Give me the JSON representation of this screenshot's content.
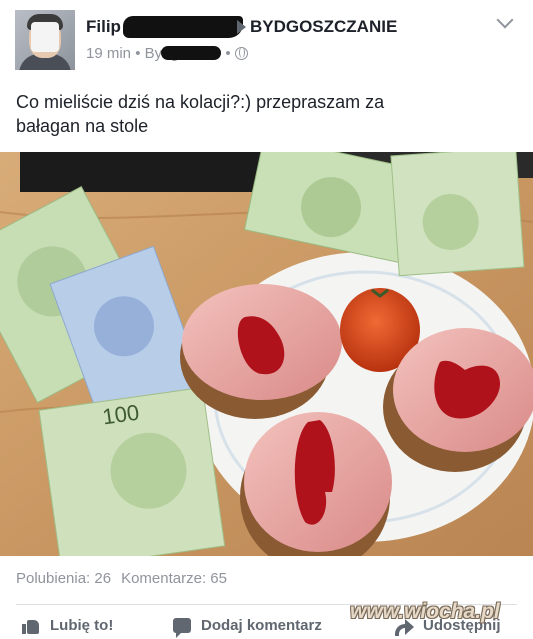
{
  "post": {
    "author_name": "Filip",
    "group_name": "BYDGOSZCZANIE",
    "time": "19 min",
    "location": "Bydgoszcz",
    "text_line1": "Co mieliście dziś na kolacji?:) przepraszam za",
    "text_line2": "bałagan na stole",
    "photo_description_icon": "photo"
  },
  "banknotes": {
    "value_label": "100",
    "value_label_rotated": "100"
  },
  "stats": {
    "likes": "Polubienia: 26",
    "comments": "Komentarze: 65"
  },
  "actions": {
    "like": "Lubię to!",
    "comment": "Dodaj komentarz",
    "share": "Udostępnij"
  },
  "watermark": "www.wiocha.pl",
  "colors": {
    "text_primary": "#1d2129",
    "text_secondary": "#90949c",
    "action_gray": "#606770",
    "ketchup": "#b0121b",
    "ham": "#e9a6a3",
    "banknote_green": "#bcd7a4"
  }
}
